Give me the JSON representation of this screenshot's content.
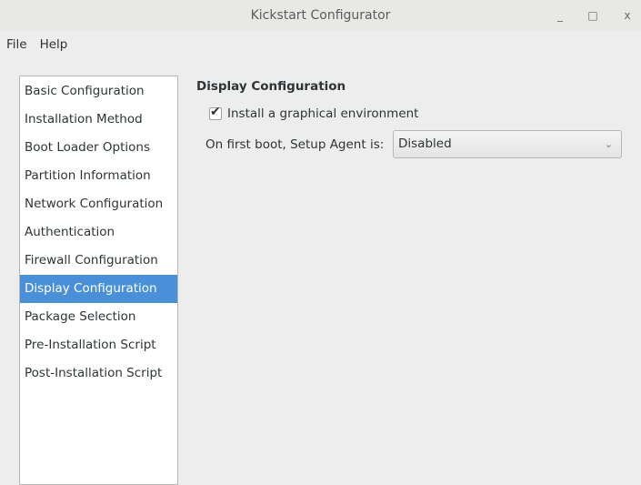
{
  "window": {
    "title": "Kickstart Configurator",
    "minimize": "_",
    "maximize": "□",
    "close": "x"
  },
  "menubar": [
    "File",
    "Help"
  ],
  "sidebar": {
    "items": [
      "Basic Configuration",
      "Installation Method",
      "Boot Loader Options",
      "Partition Information",
      "Network Configuration",
      "Authentication",
      "Firewall Configuration",
      "Display Configuration",
      "Package Selection",
      "Pre-Installation Script",
      "Post-Installation Script"
    ],
    "selected": "Display Configuration"
  },
  "main": {
    "heading": "Display Configuration",
    "graphical_checkbox": {
      "label": "Install a graphical environment",
      "checked": true
    },
    "setup_agent": {
      "label": "On first boot, Setup Agent is:",
      "value": "Disabled"
    }
  },
  "colors": {
    "selection": "#4a90d9"
  }
}
